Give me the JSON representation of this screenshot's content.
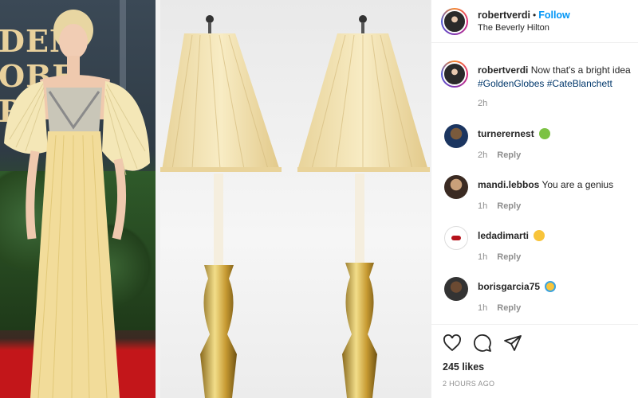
{
  "post": {
    "username": "robertverdi",
    "separator": "•",
    "follow_label": "Follow",
    "location": "The Beverly Hilton"
  },
  "photo": {
    "sign_letters": "DEN\nOBE\nRD"
  },
  "caption": {
    "username": "robertverdi",
    "text_line1": "Now that's a bright idea",
    "text_line2": "#GoldenGlobes #CateBlanchett",
    "time": "2h"
  },
  "comments": [
    {
      "username": "turnerernest",
      "text": "",
      "emoji": "nauseated-face-emoji",
      "time": "2h",
      "reply_label": "Reply"
    },
    {
      "username": "mandi.lebbos",
      "text": "You are a genius",
      "emoji": "",
      "time": "1h",
      "reply_label": "Reply"
    },
    {
      "username": "ledadimarti",
      "text": "",
      "emoji": "rolling-on-floor-laughing-emoji",
      "time": "1h",
      "reply_label": "Reply"
    },
    {
      "username": "borisgarcia75",
      "text": "",
      "emoji": "grimacing-face-mask-emoji",
      "time": "1h",
      "reply_label": "Reply"
    }
  ],
  "actions": {
    "icons": [
      "heart-icon",
      "comment-icon",
      "share-icon"
    ],
    "likes": "245 likes",
    "posted": "2 HOURS AGO"
  },
  "colors": {
    "link_blue": "#0095f6",
    "muted": "#8e8e8e",
    "text": "#262626"
  }
}
